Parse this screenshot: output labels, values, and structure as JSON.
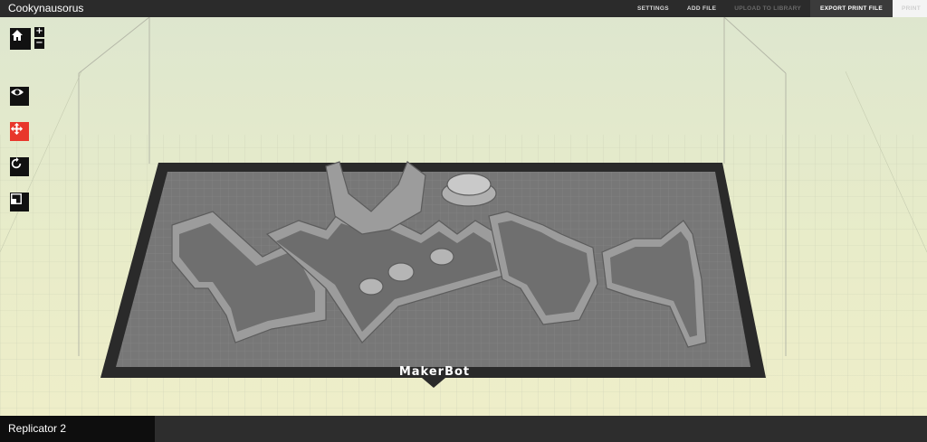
{
  "app": {
    "title": "Cookynausorus"
  },
  "menu": {
    "settings": "SETTINGS",
    "add_file": "ADD FILE",
    "upload": "UPLOAD TO LIBRARY",
    "export": "EXPORT PRINT FILE",
    "print": "PRINT"
  },
  "toolbar": {
    "zoom_in": "+",
    "zoom_out": "−"
  },
  "platform": {
    "brand": "MakerBot"
  },
  "status": {
    "printer": "Replicator 2"
  },
  "colors": {
    "accent": "#e8362b",
    "topbar": "#2b2b2b",
    "platform_frame": "#2a2a2a",
    "platform_bed": "#7a7a7a",
    "model": "#9a9a9a"
  }
}
